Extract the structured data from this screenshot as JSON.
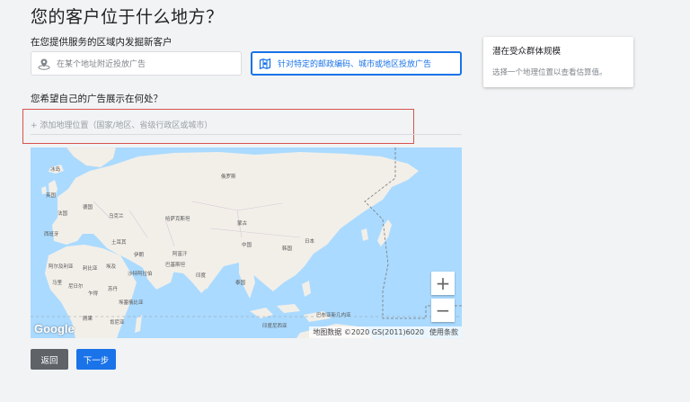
{
  "page": {
    "title": "您的客户位于什么地方？",
    "targeting_question": "在您提供服务的区域内发掘新客户",
    "option_nearby": "在某个地址附近投放广告",
    "option_regions": "针对特定的邮政编码、城市或地区投放广告",
    "location_question": "您希望自己的广告展示在何处？",
    "location_placeholder": "+ 添加地理位置（国家/地区、省级行政区或城市）"
  },
  "audience_card": {
    "title": "潜在受众群体规模",
    "hint": "选择一个地理位置以查看估算值。"
  },
  "map": {
    "logo": "Google",
    "attribution": "地图数据 ©2020 GS(2011)6020",
    "terms": "使用条款",
    "zoom_in": "+",
    "zoom_out": "−",
    "labels": [
      {
        "text": "冰岛"
      },
      {
        "text": "俄罗斯"
      },
      {
        "text": "英国"
      },
      {
        "text": "法国"
      },
      {
        "text": "西班牙"
      },
      {
        "text": "德国"
      },
      {
        "text": "乌克兰"
      },
      {
        "text": "哈萨克斯坦"
      },
      {
        "text": "蒙古"
      },
      {
        "text": "中国"
      },
      {
        "text": "日本"
      },
      {
        "text": "韩国"
      },
      {
        "text": "土耳其"
      },
      {
        "text": "伊朗"
      },
      {
        "text": "阿富汗"
      },
      {
        "text": "巴基斯坦"
      },
      {
        "text": "印度"
      },
      {
        "text": "沙特阿拉伯"
      },
      {
        "text": "阿尔及利亚"
      },
      {
        "text": "利比亚"
      },
      {
        "text": "埃及"
      },
      {
        "text": "马里"
      },
      {
        "text": "尼日尔"
      },
      {
        "text": "乍得"
      },
      {
        "text": "苏丹"
      },
      {
        "text": "埃塞俄比亚"
      },
      {
        "text": "刚果"
      },
      {
        "text": "肯尼亚"
      },
      {
        "text": "泰国"
      },
      {
        "text": "印度尼西亚"
      },
      {
        "text": "巴布亚新几内亚"
      }
    ]
  },
  "buttons": {
    "back": "返回",
    "next": "下一步"
  },
  "colors": {
    "accent": "#1a73e8",
    "highlight_border": "#d9534f",
    "water": "#aadaff",
    "land": "#f2efe9"
  },
  "icons": {
    "nearby": "map-pin-icon",
    "regions": "map-region-icon"
  }
}
